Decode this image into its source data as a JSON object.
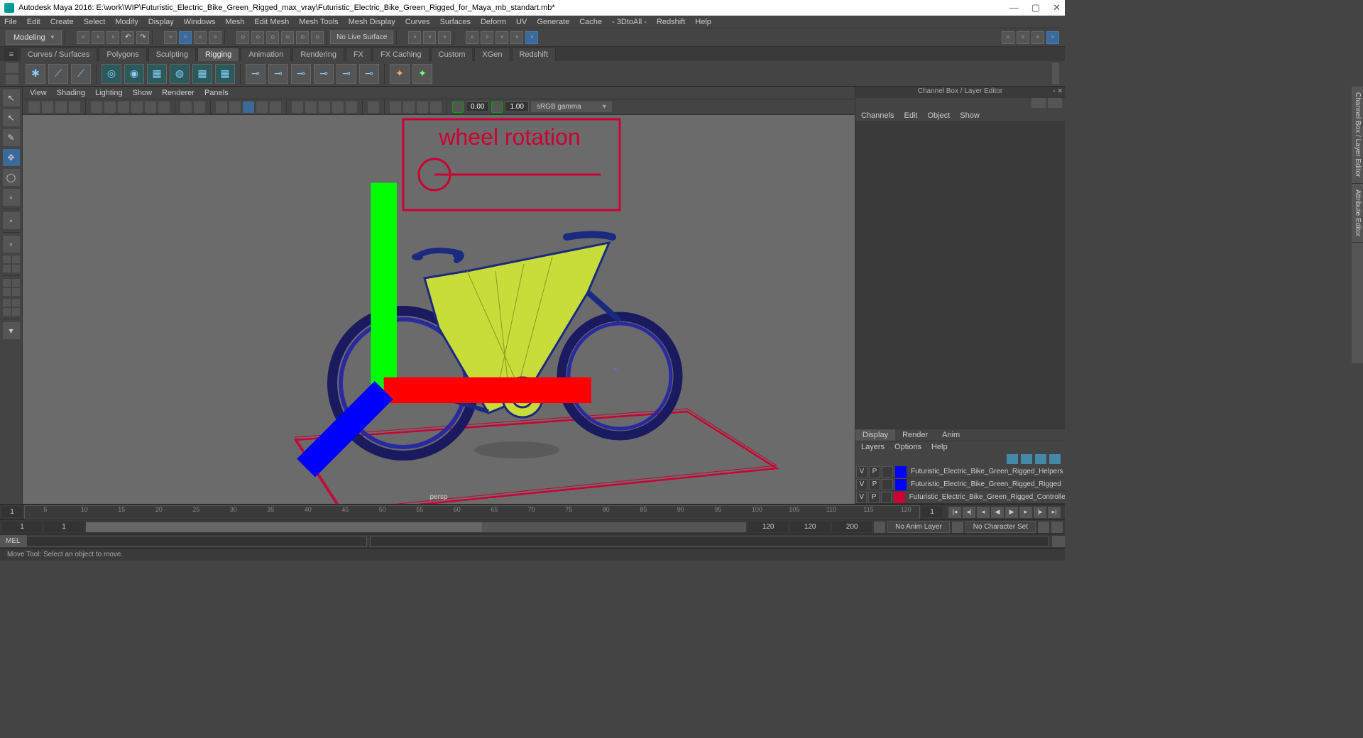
{
  "titlebar": {
    "title": "Autodesk Maya 2016: E:\\work\\WIP\\Futuristic_Electric_Bike_Green_Rigged_max_vray\\Futuristic_Electric_Bike_Green_Rigged_for_Maya_mb_standart.mb*"
  },
  "menubar": [
    "File",
    "Edit",
    "Create",
    "Select",
    "Modify",
    "Display",
    "Windows",
    "Mesh",
    "Edit Mesh",
    "Mesh Tools",
    "Mesh Display",
    "Curves",
    "Surfaces",
    "Deform",
    "UV",
    "Generate",
    "Cache",
    "- 3DtoAll -",
    "Redshift",
    "Help"
  ],
  "workspace": "Modeling",
  "livesurface": "No Live Surface",
  "shelftabs": [
    "Curves / Surfaces",
    "Polygons",
    "Sculpting",
    "Rigging",
    "Animation",
    "Rendering",
    "FX",
    "FX Caching",
    "Custom",
    "XGen",
    "Redshift"
  ],
  "shelf_active": "Rigging",
  "vpmenu": [
    "View",
    "Shading",
    "Lighting",
    "Show",
    "Renderer",
    "Panels"
  ],
  "vp_num1": "0.00",
  "vp_num2": "1.00",
  "vp_colorspace": "sRGB gamma",
  "viewport_annotation": "wheel rotation",
  "viewport_camera": "persp",
  "channelbox": {
    "title": "Channel Box / Layer Editor",
    "menu": [
      "Channels",
      "Edit",
      "Object",
      "Show"
    ],
    "tabs": [
      "Display",
      "Render",
      "Anim"
    ],
    "tab_active": "Display",
    "layermenu": [
      "Layers",
      "Options",
      "Help"
    ],
    "layers": [
      {
        "v": "V",
        "p": "P",
        "color": "#0000ff",
        "name": "Futuristic_Electric_Bike_Green_Rigged_Helpers"
      },
      {
        "v": "V",
        "p": "P",
        "color": "#0000ff",
        "name": "Futuristic_Electric_Bike_Green_Rigged_Rigged"
      },
      {
        "v": "V",
        "p": "P",
        "color": "#cc0033",
        "name": "Futuristic_Electric_Bike_Green_Rigged_Controllers"
      }
    ]
  },
  "sidetabs": [
    "Channel Box / Layer Editor",
    "Attribute Editor"
  ],
  "timeline": {
    "start": "1",
    "end": "1",
    "ticks": [
      "5",
      "10",
      "15",
      "20",
      "25",
      "30",
      "35",
      "40",
      "45",
      "50",
      "55",
      "60",
      "65",
      "70",
      "75",
      "80",
      "85",
      "90",
      "95",
      "100",
      "105",
      "110",
      "115",
      "120"
    ]
  },
  "range": {
    "rstart": "1",
    "rend": "1",
    "pstart": "120",
    "pend": "120",
    "fps": "200",
    "animlayer": "No Anim Layer",
    "charset": "No Character Set"
  },
  "cmd": {
    "lang": "MEL"
  },
  "help": "Move Tool: Select an object to move."
}
